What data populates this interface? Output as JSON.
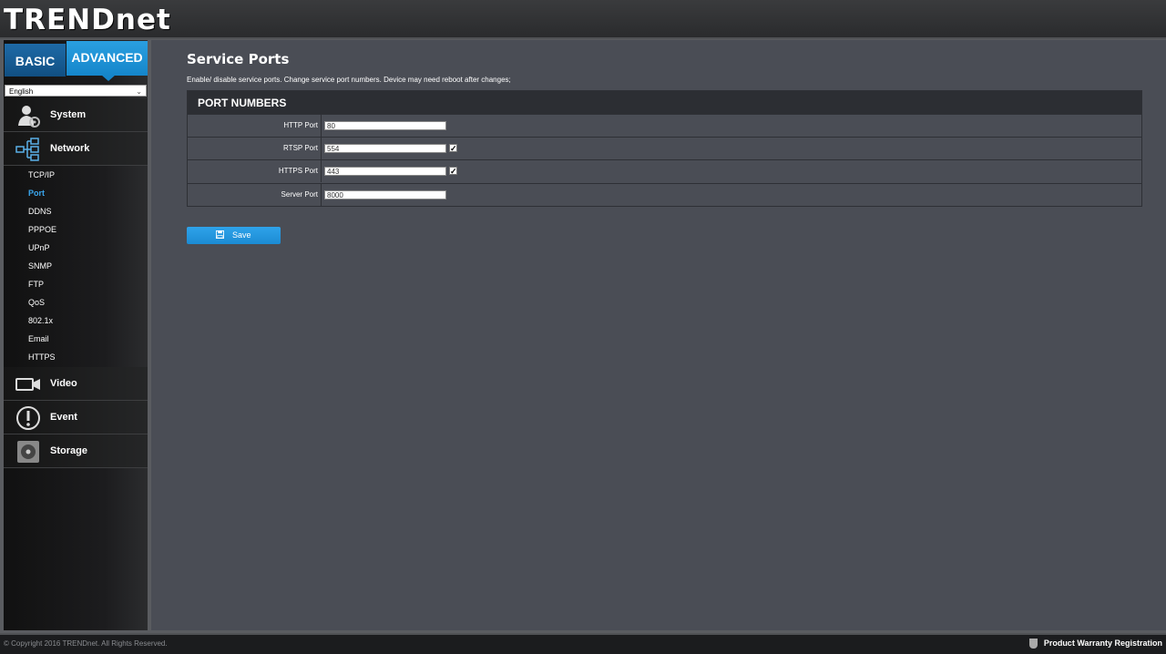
{
  "brand": {
    "logo": "TRENDnet"
  },
  "mode_tabs": {
    "basic": "BASIC",
    "advanced": "ADVANCED"
  },
  "language": {
    "selected": "English"
  },
  "sidebar": {
    "items": [
      {
        "label": "System",
        "icon": "system-user-gear-icon"
      },
      {
        "label": "Network",
        "icon": "network-tree-icon"
      },
      {
        "label": "Video",
        "icon": "video-camera-icon"
      },
      {
        "label": "Event",
        "icon": "exclamation-icon"
      },
      {
        "label": "Storage",
        "icon": "storage-disk-icon"
      }
    ],
    "network_sub": [
      "TCP/IP",
      "Port",
      "DDNS",
      "PPPOE",
      "UPnP",
      "SNMP",
      "FTP",
      "QoS",
      "802.1x",
      "Email",
      "HTTPS"
    ],
    "active_sub": "Port"
  },
  "main": {
    "title": "Service Ports",
    "description": "Enable/ disable service ports. Change service port numbers. Device may need reboot after changes;",
    "panel_title": "PORT NUMBERS",
    "rows": [
      {
        "label": "HTTP Port",
        "value": "80",
        "checkbox": false
      },
      {
        "label": "RTSP Port",
        "value": "554",
        "checkbox": true,
        "checked": true
      },
      {
        "label": "HTTPS Port",
        "value": "443",
        "checkbox": true,
        "checked": true
      },
      {
        "label": "Server Port",
        "value": "8000",
        "checkbox": false
      }
    ],
    "save_label": "Save"
  },
  "footer": {
    "copyright": "© Copyright 2016 TRENDnet. All Rights Reserved.",
    "warranty": "Product Warranty Registration"
  },
  "colors": {
    "accent": "#1b8bd3",
    "active_link": "#3aa7ee",
    "panel_header": "#2c2e33",
    "main_bg": "#4a4d55"
  }
}
